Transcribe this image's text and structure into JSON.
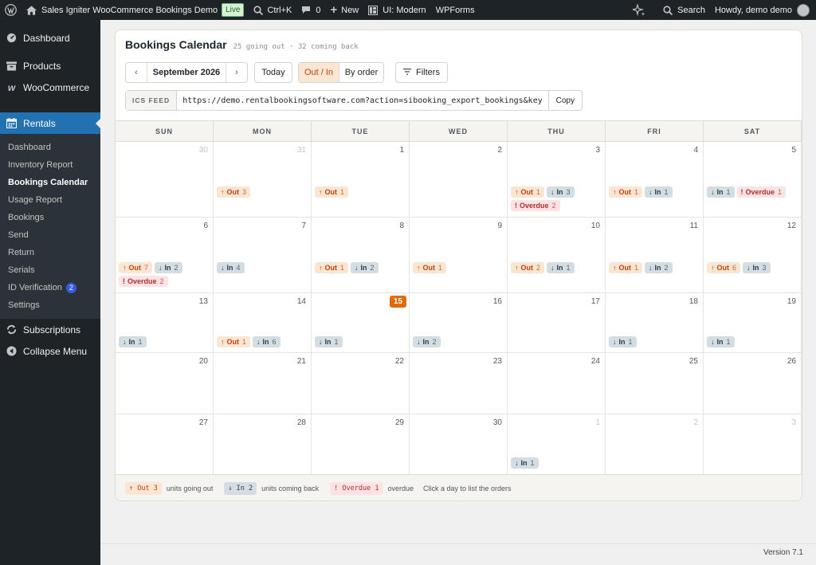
{
  "adminbar": {
    "site_name": "Sales Igniter WooCommerce Bookings Demo",
    "live_badge": "Live",
    "shortcut": "Ctrl+K",
    "comments_count": "0",
    "new_label": "New",
    "ui_label": "UI: Modern",
    "wpforms_label": "WPForms",
    "search_label": "Search",
    "howdy": "Howdy, demo demo"
  },
  "sidebar": {
    "dashboard": "Dashboard",
    "products": "Products",
    "woocommerce": "WooCommerce",
    "rentals": "Rentals",
    "submenu": [
      {
        "label": "Dashboard"
      },
      {
        "label": "Inventory Report"
      },
      {
        "label": "Bookings Calendar"
      },
      {
        "label": "Usage Report"
      },
      {
        "label": "Bookings"
      },
      {
        "label": "Send"
      },
      {
        "label": "Return"
      },
      {
        "label": "Serials"
      },
      {
        "label": "ID Verification",
        "badge": "2"
      },
      {
        "label": "Settings"
      }
    ],
    "subscriptions": "Subscriptions",
    "collapse": "Collapse Menu"
  },
  "page": {
    "title": "Bookings Calendar",
    "subtitle": "25 going out · 32 coming back"
  },
  "toolbar": {
    "prev": "‹",
    "month": "September 2026",
    "next": "›",
    "today": "Today",
    "mode_out_in": "Out / In",
    "mode_by_order": "By order",
    "filters": "Filters",
    "ics_label": "ICS FEED",
    "ics_url": "https://demo.rentalbookingsoftware.com?action=sibooking_export_bookings&key",
    "copy": "Copy"
  },
  "calendar": {
    "weekdays": [
      "SUN",
      "MON",
      "TUE",
      "WED",
      "THU",
      "FRI",
      "SAT"
    ],
    "out_label": "Out",
    "in_label": "In",
    "overdue_label": "Overdue",
    "weeks": [
      [
        {
          "day": "30",
          "other": true,
          "chips": []
        },
        {
          "day": "31",
          "other": true,
          "chips": [
            {
              "t": "out",
              "n": "3"
            }
          ]
        },
        {
          "day": "1",
          "chips": [
            {
              "t": "out",
              "n": "1"
            }
          ]
        },
        {
          "day": "2",
          "chips": []
        },
        {
          "day": "3",
          "chips": [
            {
              "t": "out",
              "n": "1"
            },
            {
              "t": "in",
              "n": "3"
            },
            {
              "t": "ov",
              "n": "2"
            }
          ]
        },
        {
          "day": "4",
          "chips": [
            {
              "t": "out",
              "n": "1"
            },
            {
              "t": "in",
              "n": "1"
            }
          ]
        },
        {
          "day": "5",
          "chips": [
            {
              "t": "in",
              "n": "1"
            },
            {
              "t": "ov",
              "n": "1"
            }
          ]
        }
      ],
      [
        {
          "day": "6",
          "chips": [
            {
              "t": "out",
              "n": "7"
            },
            {
              "t": "in",
              "n": "2"
            },
            {
              "t": "ov",
              "n": "2"
            }
          ]
        },
        {
          "day": "7",
          "chips": [
            {
              "t": "in",
              "n": "4"
            }
          ]
        },
        {
          "day": "8",
          "chips": [
            {
              "t": "out",
              "n": "1"
            },
            {
              "t": "in",
              "n": "2"
            }
          ]
        },
        {
          "day": "9",
          "chips": [
            {
              "t": "out",
              "n": "1"
            }
          ]
        },
        {
          "day": "10",
          "chips": [
            {
              "t": "out",
              "n": "2"
            },
            {
              "t": "in",
              "n": "1"
            }
          ]
        },
        {
          "day": "11",
          "chips": [
            {
              "t": "out",
              "n": "1"
            },
            {
              "t": "in",
              "n": "2"
            }
          ]
        },
        {
          "day": "12",
          "chips": [
            {
              "t": "out",
              "n": "6"
            },
            {
              "t": "in",
              "n": "3"
            }
          ]
        }
      ],
      [
        {
          "day": "13",
          "chips": [
            {
              "t": "in",
              "n": "1"
            }
          ]
        },
        {
          "day": "14",
          "chips": [
            {
              "t": "out",
              "n": "1"
            },
            {
              "t": "in",
              "n": "6"
            }
          ]
        },
        {
          "day": "15",
          "today": true,
          "chips": [
            {
              "t": "in",
              "n": "1"
            }
          ]
        },
        {
          "day": "16",
          "chips": [
            {
              "t": "in",
              "n": "2"
            }
          ]
        },
        {
          "day": "17",
          "chips": []
        },
        {
          "day": "18",
          "chips": [
            {
              "t": "in",
              "n": "1"
            }
          ]
        },
        {
          "day": "19",
          "chips": [
            {
              "t": "in",
              "n": "1"
            }
          ]
        }
      ],
      [
        {
          "day": "20",
          "chips": []
        },
        {
          "day": "21",
          "chips": []
        },
        {
          "day": "22",
          "chips": []
        },
        {
          "day": "23",
          "chips": []
        },
        {
          "day": "24",
          "chips": []
        },
        {
          "day": "25",
          "chips": []
        },
        {
          "day": "26",
          "chips": []
        }
      ],
      [
        {
          "day": "27",
          "chips": []
        },
        {
          "day": "28",
          "chips": []
        },
        {
          "day": "29",
          "chips": []
        },
        {
          "day": "30",
          "chips": []
        },
        {
          "day": "1",
          "other": true,
          "chips": [
            {
              "t": "in",
              "n": "1"
            }
          ]
        },
        {
          "day": "2",
          "other": true,
          "chips": []
        },
        {
          "day": "3",
          "other": true,
          "chips": []
        }
      ]
    ]
  },
  "legend": {
    "out_chip": "↑ Out 3",
    "out_text": "units going out",
    "in_chip": "↓ In 2",
    "in_text": "units coming back",
    "ov_chip": "! Overdue 1",
    "ov_text": "overdue",
    "hint": "Click a day to list the orders"
  },
  "footer": {
    "version": "Version 7.1"
  },
  "colors": {
    "accent": "#2271b1",
    "out": "#c2410c",
    "in": "#2c3e4c",
    "overdue": "#b32d2e",
    "today": "#e26a0e"
  }
}
